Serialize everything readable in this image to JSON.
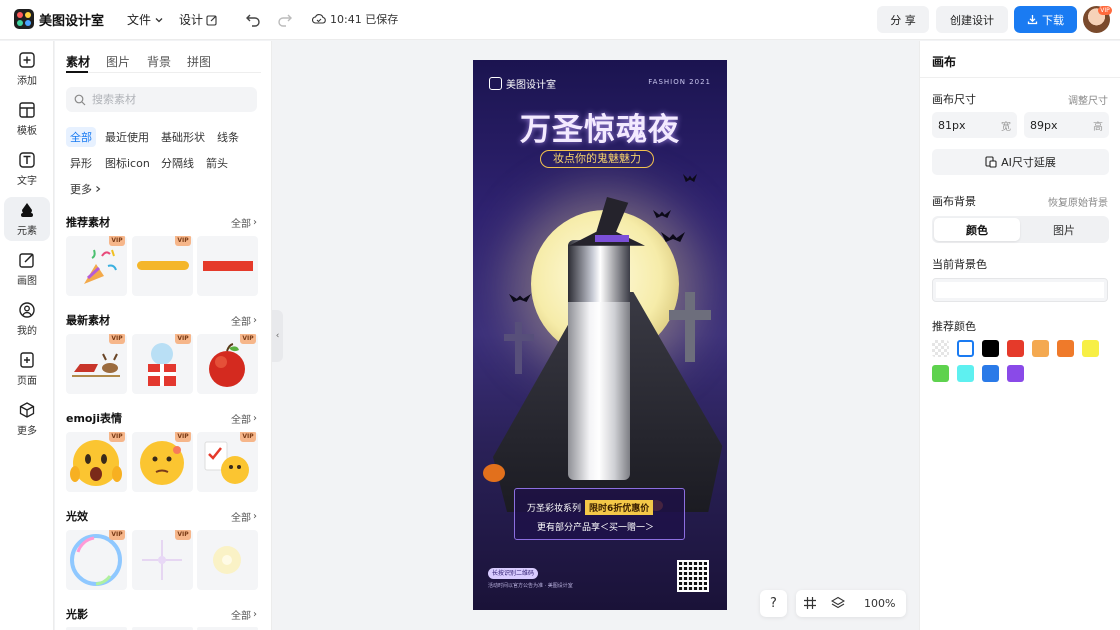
{
  "app": {
    "name": "美图设计室"
  },
  "topbar": {
    "file_menu": "文件",
    "design_menu": "设计",
    "save_status": "10:41 已保存",
    "share": "分 享",
    "create": "创建设计",
    "download": "下载",
    "avatar_badge": "VIP"
  },
  "rail": {
    "items": [
      {
        "label": "添加",
        "icon": "plus-square-icon"
      },
      {
        "label": "模板",
        "icon": "layout-icon"
      },
      {
        "label": "文字",
        "icon": "text-icon"
      },
      {
        "label": "元素",
        "icon": "shapes-icon"
      },
      {
        "label": "画图",
        "icon": "pen-edit-icon"
      },
      {
        "label": "我的",
        "icon": "user-icon"
      },
      {
        "label": "页面",
        "icon": "add-page-icon"
      },
      {
        "label": "更多",
        "icon": "cube-icon"
      }
    ],
    "active_index": 3
  },
  "panel": {
    "tabs": [
      "素材",
      "图片",
      "背景",
      "拼图"
    ],
    "active_tab": 0,
    "search_placeholder": "搜索素材",
    "chips": [
      "全部",
      "最近使用",
      "基础形状",
      "线条",
      "异形",
      "图标icon",
      "分隔线",
      "箭头",
      "更多"
    ],
    "active_chip": 0,
    "sections": [
      {
        "title": "推荐素材",
        "all": "全部"
      },
      {
        "title": "最新素材",
        "all": "全部"
      },
      {
        "title": "emoji表情",
        "all": "全部"
      },
      {
        "title": "光效",
        "all": "全部"
      },
      {
        "title": "光影",
        "all": "全部"
      }
    ],
    "vip_badge": "VIP"
  },
  "poster": {
    "brand": "美图设计室",
    "tag": "FASHION 2021",
    "title": "万圣惊魂夜",
    "subtitle": "妆点你的鬼魅魅力",
    "promo_series": "万圣彩妆系列",
    "promo_highlight": "限时6折优惠价",
    "promo_line2": "更有部分产品享＜买一赠一＞",
    "pill": "长按识别二维码",
    "fine_print": "活动时间以官方公告为准 · 美图设计室"
  },
  "controls": {
    "help": "?",
    "zoom": "100%"
  },
  "right": {
    "title": "画布",
    "size_label": "画布尺寸",
    "size_link": "调整尺寸",
    "width_value": "81px",
    "width_unit": "宽",
    "height_value": "89px",
    "height_unit": "高",
    "ai_extend": "AI尺寸延展",
    "bg_label": "画布背景",
    "bg_reset": "恢复原始背景",
    "seg_color": "颜色",
    "seg_image": "图片",
    "current_bg": "当前背景色",
    "recommend": "推荐颜色",
    "swatches": [
      "transparent",
      "#ffffff",
      "#000000",
      "#e53a2a",
      "#f4a950",
      "#ef7a2a",
      "#f7ef45",
      "#5ed24e",
      "#5ef0f0",
      "#2a7ae8",
      "#8a4ae8"
    ]
  }
}
